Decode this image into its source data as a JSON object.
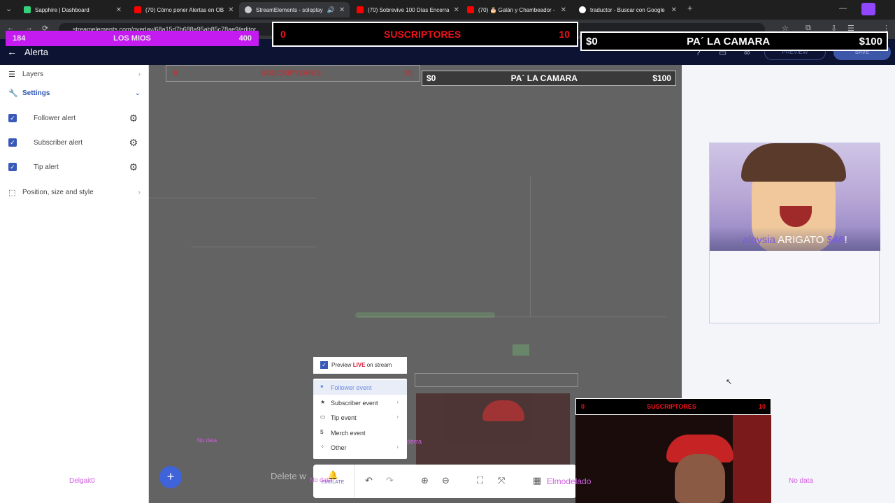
{
  "browser": {
    "tabs": [
      {
        "title": "Sapphire | Dashboard",
        "color": "#3a8ee6"
      },
      {
        "title": "(70) Cómo poner Alertas en OB",
        "color": "#ff0000"
      },
      {
        "title": "StreamElements - soloplay",
        "color": "#cccccc"
      },
      {
        "title": "(70) Sobrevive 100 Días Encerra",
        "color": "#ff0000"
      },
      {
        "title": "(70) 🎂 Galán y Chambeador -",
        "color": "#ff0000"
      },
      {
        "title": "traductor - Buscar con Google",
        "color": "#ffffff"
      }
    ],
    "url": "streamelements.com/overlay/68a15d7b688a95ab85c78ae9/editor"
  },
  "header": {
    "title": "Alerta",
    "preview_label": "PREVIEW",
    "save_label": "SAVE"
  },
  "sidebar": {
    "layers": "Layers",
    "settings": "Settings",
    "items": [
      {
        "label": "Follower alert"
      },
      {
        "label": "Subscriber alert"
      },
      {
        "label": "Tip alert"
      }
    ],
    "position": "Position, size and style"
  },
  "overlay": {
    "sub_goal": {
      "current": "0",
      "label": "SUSCRIPTORES",
      "target": "10"
    },
    "money_goal": {
      "current": "$0",
      "label": "PA´ LA CAMARA",
      "target": "$100"
    },
    "left_goal": {
      "current": "184",
      "label": "LOS MIOS",
      "target": "400"
    }
  },
  "menu": {
    "preview_live_prefix": "Preview",
    "preview_live_bold": "LIVE",
    "preview_live_suffix": "on stream",
    "events": [
      {
        "label": "Follower event",
        "icon": "heart-icon",
        "has_sub": false
      },
      {
        "label": "Subscriber event",
        "icon": "star-icon",
        "has_sub": true
      },
      {
        "label": "Tip event",
        "icon": "card-icon",
        "has_sub": true
      },
      {
        "label": "Merch event",
        "icon": "dollar-icon",
        "has_sub": false
      },
      {
        "label": "Other",
        "icon": "dots-icon",
        "has_sub": true
      }
    ]
  },
  "toolbar": {
    "emulate": "EMULATE",
    "delete_hint": "Delete w"
  },
  "alert_preview": {
    "username": "aloysia",
    "text": "ARIGATO",
    "amount": "$46",
    "bang": "!"
  },
  "overlay_labels": {
    "nodata_left": "No data",
    "nodata_mid": "No data",
    "nodata_right": "No data",
    "name_left": "Delgait0",
    "name_mid": "Elmodelado",
    "name_cam": "derra"
  },
  "colors": {
    "accent": "#3959b8",
    "sub_red": "#f1131a",
    "purple_label": "#c84fe0",
    "header_bg": "#0d1433"
  }
}
